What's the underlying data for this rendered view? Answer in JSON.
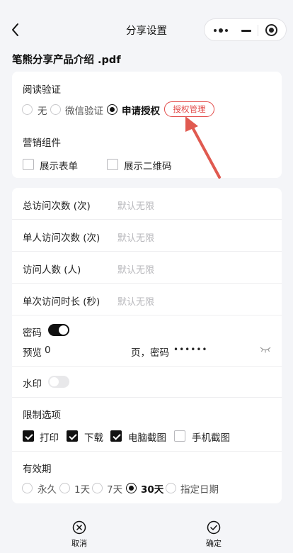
{
  "nav": {
    "title": "分享设置"
  },
  "file": {
    "name": "笔熊分享产品介绍 .pdf"
  },
  "reading": {
    "title": "阅读验证",
    "options": [
      {
        "label": "无",
        "selected": false
      },
      {
        "label": "微信验证",
        "selected": false
      },
      {
        "label": "申请授权",
        "selected": true
      }
    ],
    "manage_label": "授权管理"
  },
  "marketing": {
    "title": "营销组件",
    "options": [
      {
        "label": "展示表单",
        "checked": false
      },
      {
        "label": "展示二维码",
        "checked": false
      }
    ]
  },
  "limits": [
    {
      "label": "总访问次数 (次)",
      "placeholder": "默认无限"
    },
    {
      "label": "单人访问次数 (次)",
      "placeholder": "默认无限"
    },
    {
      "label": "访问人数 (人)",
      "placeholder": "默认无限"
    },
    {
      "label": "单次访问时长 (秒)",
      "placeholder": "默认无限"
    }
  ],
  "password": {
    "label": "密码",
    "enabled": true,
    "preview_label": "预览",
    "preview_value": "0",
    "page_password_label": "页，密码",
    "password_mask": "••••••"
  },
  "watermark": {
    "label": "水印",
    "enabled": false
  },
  "restrictions": {
    "title": "限制选项",
    "options": [
      {
        "label": "打印",
        "checked": true
      },
      {
        "label": "下载",
        "checked": true
      },
      {
        "label": "电脑截图",
        "checked": true
      },
      {
        "label": "手机截图",
        "checked": false
      }
    ]
  },
  "validity": {
    "title": "有效期",
    "options": [
      {
        "label": "永久",
        "selected": false
      },
      {
        "label": "1天",
        "selected": false
      },
      {
        "label": "7天",
        "selected": false
      },
      {
        "label": "30天",
        "selected": true
      },
      {
        "label": "指定日期",
        "selected": false
      }
    ]
  },
  "actions": {
    "cancel_label": "取消",
    "confirm_label": "确定"
  },
  "colors": {
    "accent": "#e24a48",
    "primary": "#111111",
    "background": "#f4f5f8"
  }
}
